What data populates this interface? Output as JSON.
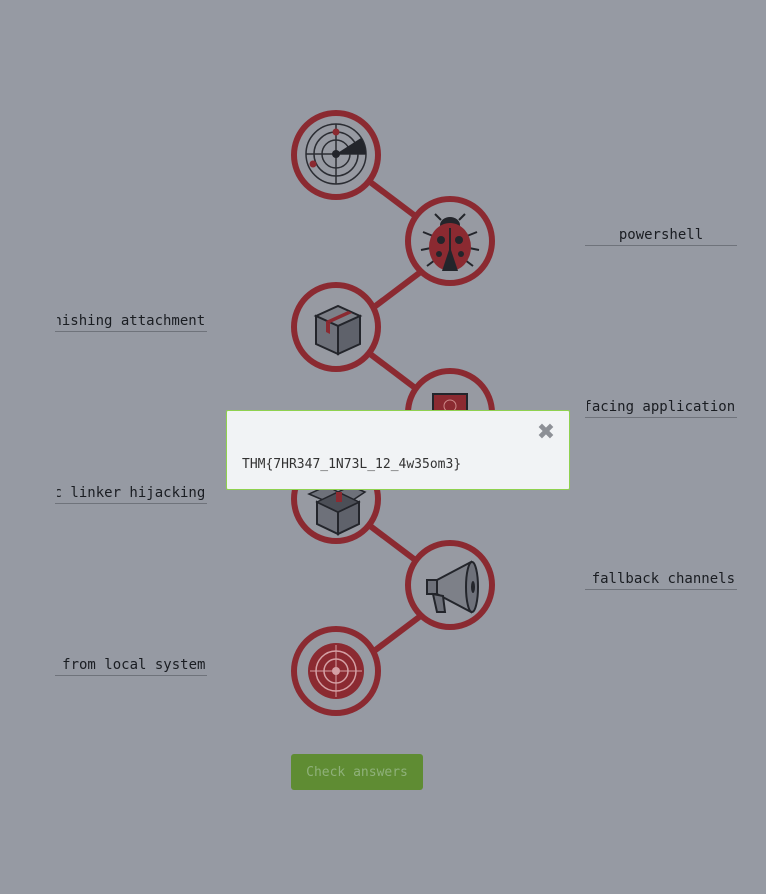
{
  "answers": {
    "left_1": "phishing attachment",
    "left_2": "dynamic linker hijacking",
    "left_3": "data from local system",
    "right_1": "powershell",
    "right_2": "exploit public-facing application",
    "right_3": "fallback channels"
  },
  "nodes": [
    {
      "icon": "radar-icon"
    },
    {
      "icon": "ladybug-icon"
    },
    {
      "icon": "box-icon"
    },
    {
      "icon": "certificate-icon"
    },
    {
      "icon": "open-box-icon"
    },
    {
      "icon": "megaphone-icon"
    },
    {
      "icon": "target-icon"
    }
  ],
  "check_button_label": "Check answers",
  "modal": {
    "flag": "THM{7HR347_1N73L_12_4w35om3}",
    "close_glyph": "✖"
  },
  "colors": {
    "background": "#969aa3",
    "ring": "#8b2a31",
    "button": "#5f8c33",
    "modal_border": "#8fd14f"
  }
}
